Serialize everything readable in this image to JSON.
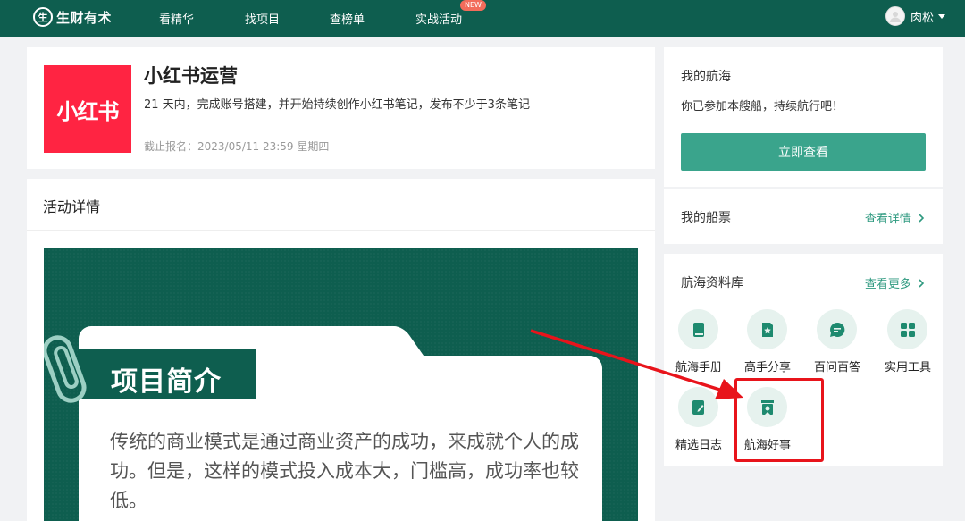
{
  "nav": {
    "logo_mark": "生",
    "logo_text": "生财有术",
    "items": [
      "看精华",
      "找项目",
      "查榜单",
      "实战活动"
    ],
    "new_badge": "NEW",
    "user_name": "肉松"
  },
  "activity": {
    "logo_text": "小红书",
    "title": "小红书运营",
    "description": "21 天内，完成账号搭建，并开始持续创作小红书笔记，发布不少于3条笔记",
    "deadline": "截止报名：2023/05/11 23:59 星期四"
  },
  "detail": {
    "heading": "活动详情",
    "poster": {
      "ribbon_title": "项目简介",
      "body": "传统的商业模式是通过商业资产的成功，来成就个人的成功。但是，这样的模式投入成本大，门槛高，成功率也较低。"
    }
  },
  "my_voyage": {
    "title": "我的航海",
    "subtitle": "你已参加本艘船，持续航行吧！",
    "button": "立即查看"
  },
  "ticket": {
    "title": "我的船票",
    "link": "查看详情"
  },
  "library": {
    "title": "航海资料库",
    "link": "查看更多",
    "items": [
      {
        "label": "航海手册",
        "icon": "book-icon"
      },
      {
        "label": "高手分享",
        "icon": "star-doc-icon"
      },
      {
        "label": "百问百答",
        "icon": "chat-bubble-icon"
      },
      {
        "label": "实用工具",
        "icon": "grid-icon"
      },
      {
        "label": "精选日志",
        "icon": "notebook-pen-icon"
      },
      {
        "label": "航海好事",
        "icon": "award-icon"
      }
    ]
  },
  "colors": {
    "brand": "#0e5e4f",
    "accent": "#3aa48c",
    "link": "#2f9a80",
    "xhs_red": "#ff2442",
    "annotation": "#e8141b"
  }
}
